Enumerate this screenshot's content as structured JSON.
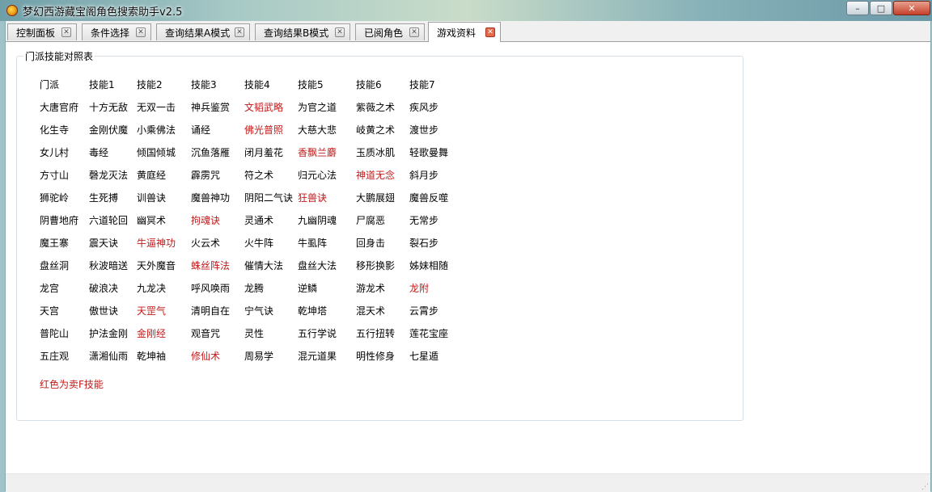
{
  "window": {
    "title": "梦幻西游藏宝阁角色搜索助手v2.5",
    "buttons": {
      "minimize": "–",
      "maximize": "□",
      "close": "✕"
    }
  },
  "tabs": [
    {
      "label": "控制面板",
      "active": false
    },
    {
      "label": "条件选择",
      "active": false
    },
    {
      "label": "查询结果A模式",
      "active": false
    },
    {
      "label": "查询结果B模式",
      "active": false
    },
    {
      "label": "已阅角色",
      "active": false
    },
    {
      "label": "游戏资料",
      "active": true
    }
  ],
  "group": {
    "title": "门派技能对照表"
  },
  "skill_table": {
    "header": [
      "门派",
      "技能1",
      "技能2",
      "技能3",
      "技能4",
      "技能5",
      "技能6",
      "技能7"
    ],
    "rows": [
      {
        "cells": [
          "大唐官府",
          "十方无敌",
          "无双一击",
          "神兵鉴赏",
          "文韬武略",
          "为官之道",
          "紫薇之术",
          "疾风步"
        ],
        "red": [
          4
        ]
      },
      {
        "cells": [
          "化生寺",
          "金刚伏魔",
          "小乘佛法",
          "诵经",
          "佛光普照",
          "大慈大悲",
          "岐黄之术",
          "渡世步"
        ],
        "red": [
          4
        ]
      },
      {
        "cells": [
          "女儿村",
          "毒经",
          "倾国倾城",
          "沉鱼落雁",
          "闭月羞花",
          "香飘兰麝",
          "玉质冰肌",
          "轻歌曼舞"
        ],
        "red": [
          5
        ]
      },
      {
        "cells": [
          "方寸山",
          "磬龙灭法",
          "黄庭经",
          "霹雳咒",
          "符之术",
          "归元心法",
          "神道无念",
          "斜月步"
        ],
        "red": [
          6
        ]
      },
      {
        "cells": [
          "狮驼岭",
          "生死搏",
          "训兽诀",
          "魔兽神功",
          "阴阳二气诀",
          "狂兽诀",
          "大鹏展翅",
          "魔兽反噬"
        ],
        "red": [
          5
        ]
      },
      {
        "cells": [
          "阴曹地府",
          "六道轮回",
          "幽冥术",
          "拘魂诀",
          "灵通术",
          "九幽阴魂",
          "尸腐恶",
          "无常步"
        ],
        "red": [
          3
        ]
      },
      {
        "cells": [
          "魔王寨",
          "震天诀",
          "牛逼神功",
          "火云术",
          "火牛阵",
          "牛虱阵",
          "回身击",
          "裂石步"
        ],
        "red": [
          2
        ]
      },
      {
        "cells": [
          "盘丝洞",
          "秋波暗送",
          "天外魔音",
          "蛛丝阵法",
          "催情大法",
          "盘丝大法",
          "移形换影",
          "姊妹相随"
        ],
        "red": [
          3
        ]
      },
      {
        "cells": [
          "龙宫",
          "破浪决",
          "九龙决",
          "呼风唤雨",
          "龙腾",
          "逆鳞",
          "游龙术",
          "龙附"
        ],
        "red": [
          7
        ]
      },
      {
        "cells": [
          "天宫",
          "傲世诀",
          "天罡气",
          "清明自在",
          "宁气诀",
          "乾坤塔",
          "混天术",
          "云霄步"
        ],
        "red": [
          2
        ]
      },
      {
        "cells": [
          "普陀山",
          "护法金刚",
          "金刚经",
          "观音咒",
          "灵性",
          "五行学说",
          "五行扭转",
          "莲花宝座"
        ],
        "red": [
          2
        ]
      },
      {
        "cells": [
          "五庄观",
          "潇湘仙雨",
          "乾坤袖",
          "修仙术",
          "周易学",
          "混元道果",
          "明性修身",
          "七星遁"
        ],
        "red": [
          3
        ]
      }
    ],
    "note": "红色为卖F技能"
  },
  "colors": {
    "red_text": "#c21a1a",
    "window_bg": "#f0f0f0",
    "content_bg": "#ffffff"
  }
}
